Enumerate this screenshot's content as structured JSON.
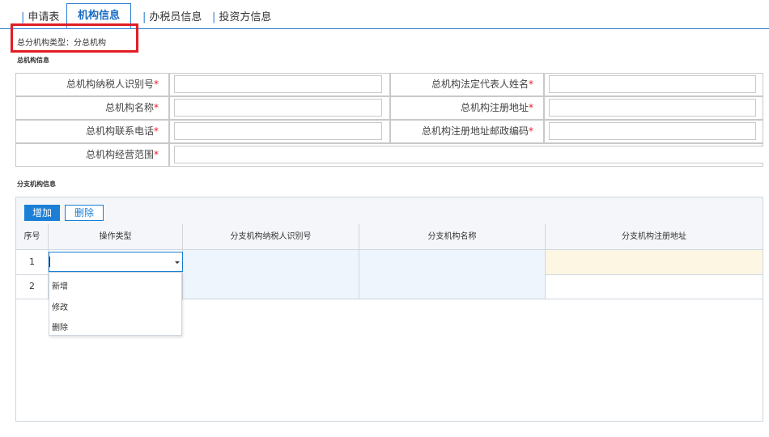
{
  "tabs": [
    {
      "label": "申请表"
    },
    {
      "label": "机构信息"
    },
    {
      "label": "办税员信息"
    },
    {
      "label": "投资方信息"
    }
  ],
  "header_type_line": "总分机构类型：分总机构",
  "section_head_office": {
    "title": "总机构信息",
    "fields": {
      "tax_id_label": "总机构纳税人识别号",
      "legal_rep_label": "总机构法定代表人姓名",
      "name_label": "总机构名称",
      "reg_address_label": "总机构注册地址",
      "phone_label": "总机构联系电话",
      "postal_label": "总机构注册地址邮政编码",
      "scope_label": "总机构经营范围",
      "required_mark": "*"
    }
  },
  "section_branch": {
    "title": "分支机构信息",
    "add_button": "增加",
    "delete_button": "删除",
    "columns": [
      "序号",
      "操作类型",
      "分支机构纳税人识别号",
      "分支机构名称",
      "分支机构注册地址"
    ],
    "rows": [
      {
        "index": "1"
      },
      {
        "index": "2"
      }
    ],
    "dropdown_options": [
      "新增",
      "修改",
      "删除"
    ]
  },
  "colors": {
    "accent": "#1b7fd6",
    "highlight_box": "#e21d24",
    "selected_cell": "#fdf6e3",
    "row_cell": "#eef5fc"
  }
}
